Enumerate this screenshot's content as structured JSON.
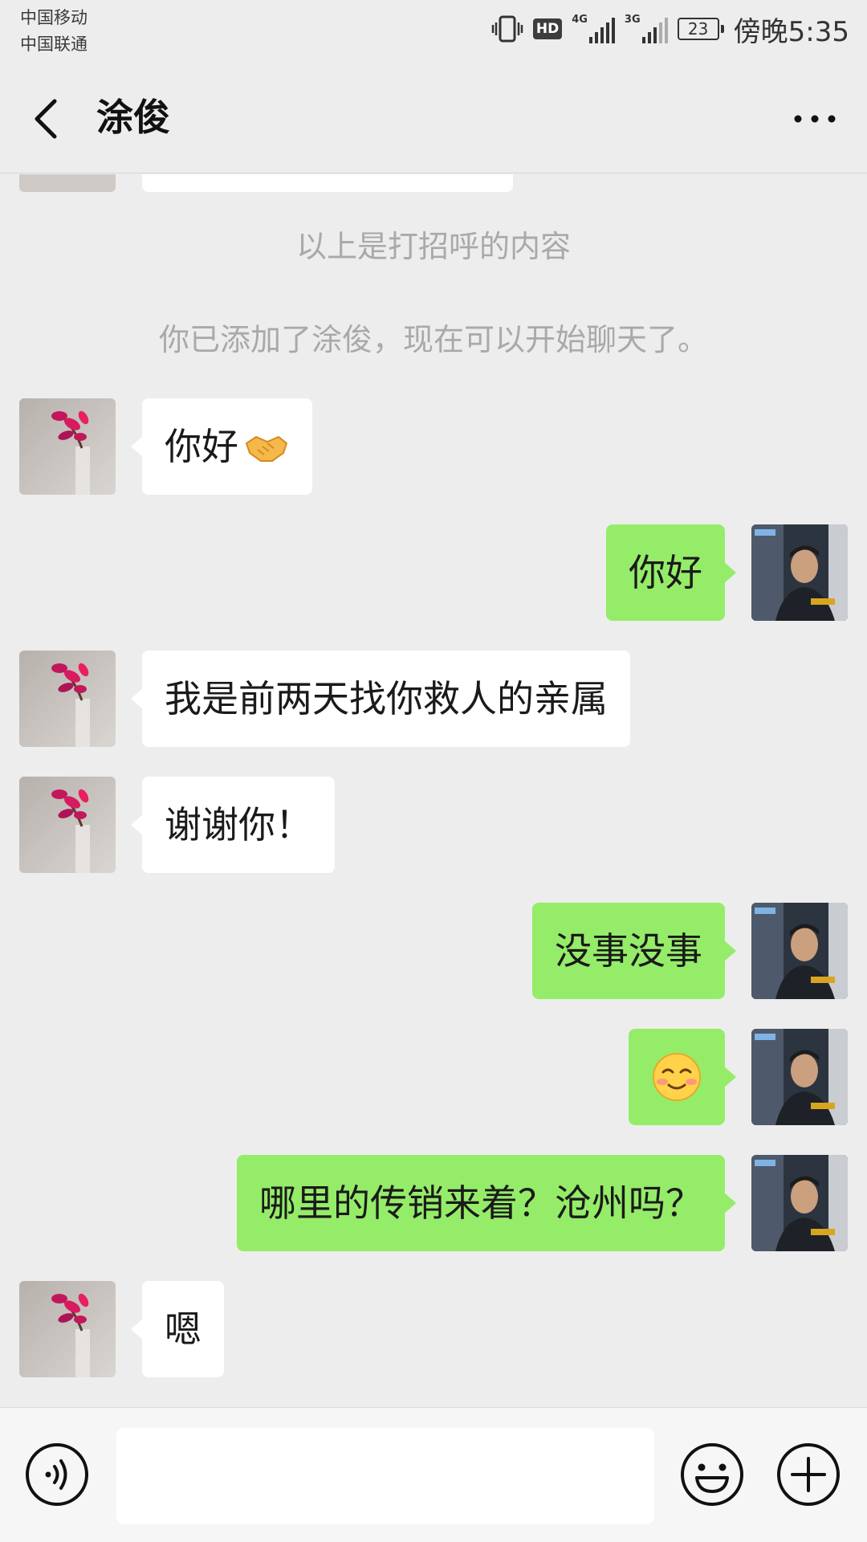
{
  "status_bar": {
    "carrier_1": "中国移动",
    "carrier_2": "中国联通",
    "hd": "HD",
    "net_1": "4G",
    "net_2": "3G",
    "battery": "23",
    "time": "傍晚5:35"
  },
  "nav": {
    "title": "涂俊"
  },
  "chat": {
    "system_messages": [
      "以上是打招呼的内容",
      "你已添加了涂俊，现在可以开始聊天了。"
    ],
    "messages": [
      {
        "from": "contact",
        "text": "你好",
        "emoji": "handshake"
      },
      {
        "from": "me",
        "text": "你好"
      },
      {
        "from": "contact",
        "text": "我是前两天找你救人的亲属"
      },
      {
        "from": "contact",
        "text": "谢谢你！"
      },
      {
        "from": "me",
        "text": "没事没事"
      },
      {
        "from": "me",
        "text": "",
        "emoji": "blush-smile"
      },
      {
        "from": "me",
        "text": "哪里的传销来着？沧州吗？"
      },
      {
        "from": "contact",
        "text": "嗯"
      }
    ]
  },
  "input_bar": {
    "message_value": ""
  },
  "colors": {
    "background": "#ededed",
    "outgoing_bubble": "#95ec69",
    "incoming_bubble": "#ffffff",
    "system_text": "#a9a9a9"
  }
}
